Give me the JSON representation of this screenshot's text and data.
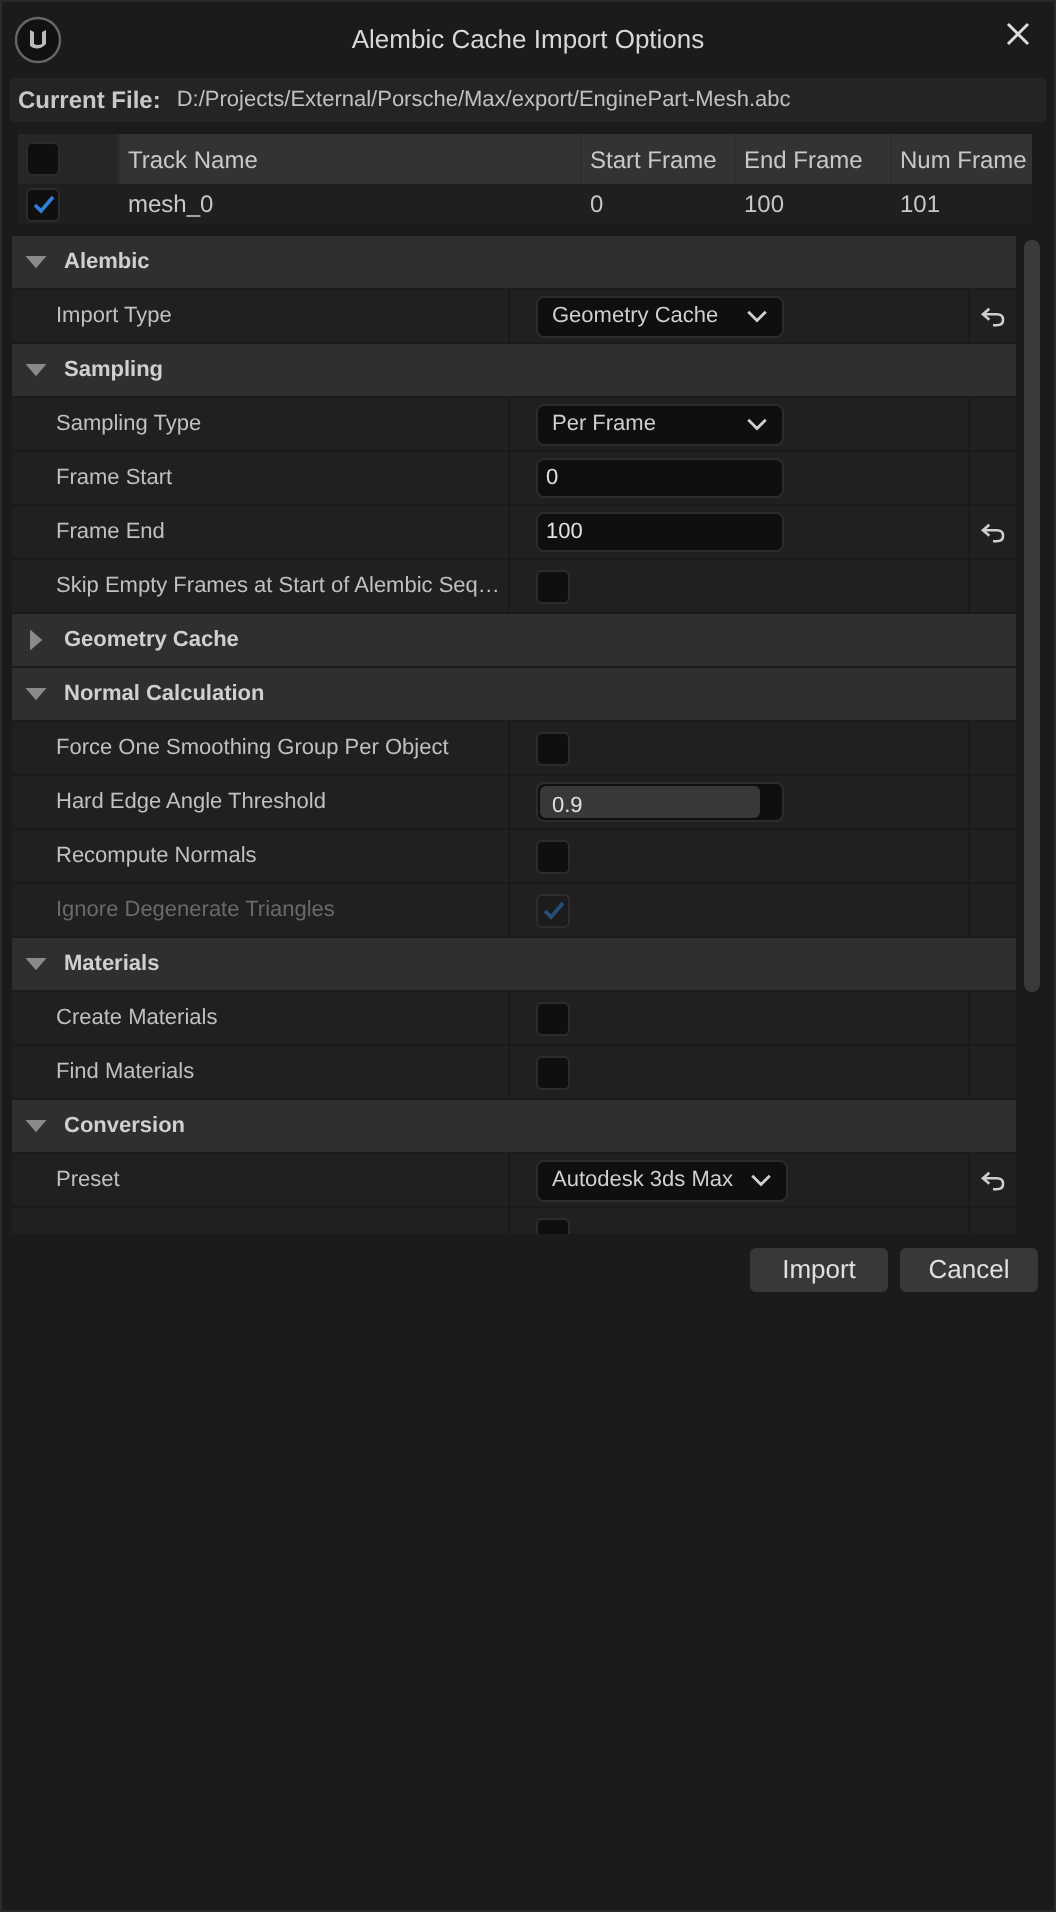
{
  "window": {
    "title": "Alembic Cache Import Options"
  },
  "current_file": {
    "label": "Current File:",
    "path": "D:/Projects/External/Porsche/Max/export/EnginePart-Mesh.abc"
  },
  "tracks": {
    "all_checked": false,
    "columns": [
      "Track Name",
      "Start Frame",
      "End Frame",
      "Num Frame"
    ],
    "rows": [
      {
        "checked": true,
        "cells": [
          "mesh_0",
          "0",
          "100",
          "101"
        ]
      }
    ]
  },
  "sections": [
    {
      "title": "Alembic",
      "expanded": true,
      "properties": [
        {
          "kind": "combo",
          "label": "Import Type",
          "value": "Geometry Cache",
          "reset": true
        }
      ]
    },
    {
      "title": "Sampling",
      "expanded": true,
      "properties": [
        {
          "kind": "combo",
          "label": "Sampling Type",
          "value": "Per Frame",
          "reset": false
        },
        {
          "kind": "text",
          "label": "Frame Start",
          "value": "0",
          "reset": false
        },
        {
          "kind": "text",
          "label": "Frame End",
          "value": "100",
          "reset": true
        },
        {
          "kind": "checkbox",
          "label": "Skip Empty Frames at Start of Alembic Seq…",
          "checked": false,
          "disabled": false,
          "reset": false
        }
      ]
    },
    {
      "title": "Geometry Cache",
      "expanded": false
    },
    {
      "title": "Normal Calculation",
      "expanded": true,
      "properties": [
        {
          "kind": "checkbox",
          "label": "Force One Smoothing Group Per Object",
          "checked": false,
          "disabled": false,
          "reset": false
        },
        {
          "kind": "slider",
          "label": "Hard Edge Angle Threshold",
          "value": "0.9",
          "level": 0.9,
          "reset": false
        },
        {
          "kind": "checkbox",
          "label": "Recompute Normals",
          "checked": false,
          "disabled": false,
          "reset": false
        },
        {
          "kind": "checkbox",
          "label": "Ignore Degenerate Triangles",
          "checked": true,
          "disabled": true,
          "reset": false
        }
      ]
    },
    {
      "title": "Materials",
      "expanded": true,
      "properties": [
        {
          "kind": "checkbox",
          "label": "Create Materials",
          "checked": false,
          "disabled": false,
          "reset": false
        },
        {
          "kind": "checkbox",
          "label": "Find Materials",
          "checked": false,
          "disabled": false,
          "reset": false
        }
      ]
    },
    {
      "title": "Conversion",
      "expanded": true,
      "properties": [
        {
          "kind": "combo",
          "label": "Preset",
          "value": "Autodesk 3ds Max",
          "reset": true
        },
        {
          "kind": "checkbox",
          "checked": false,
          "disabled": false,
          "reset": false
        }
      ]
    }
  ],
  "buttons": [
    "Import",
    "Cancel"
  ]
}
